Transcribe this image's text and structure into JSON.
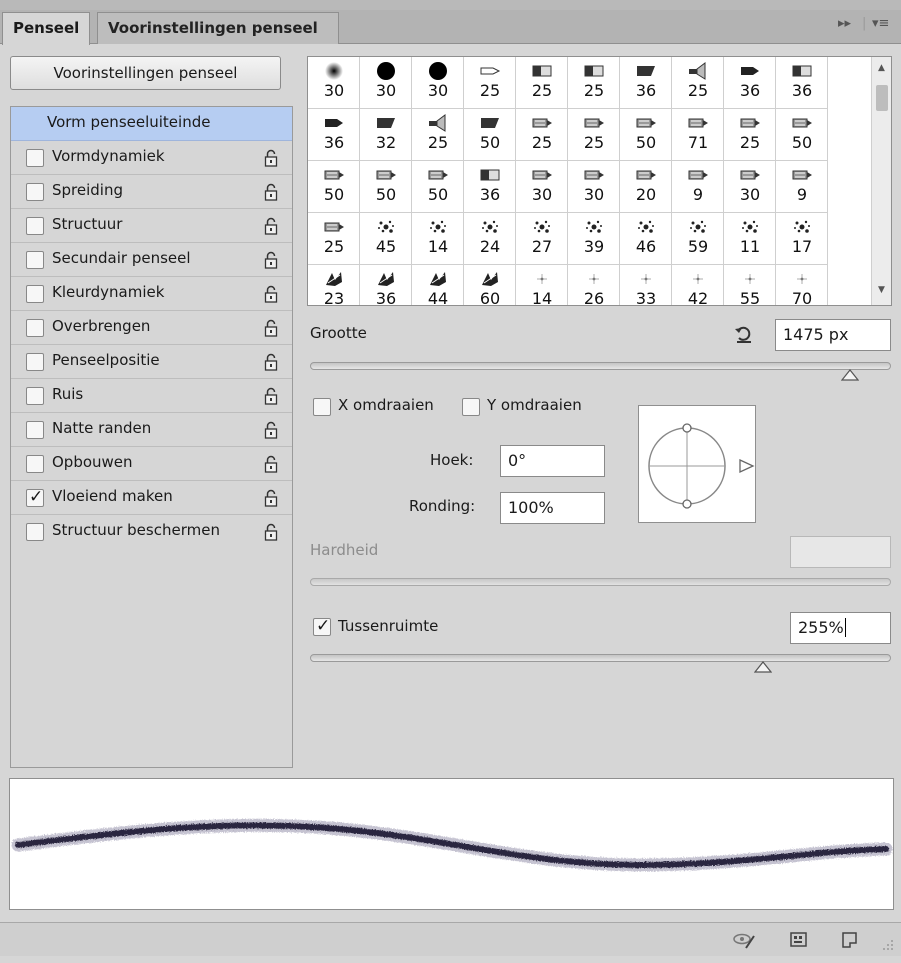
{
  "tabs": [
    {
      "label": "Penseel",
      "active": true
    },
    {
      "label": "Voorinstellingen penseel",
      "active": false
    }
  ],
  "preset_button": "Voorinstellingen penseel",
  "options": {
    "header": "Vorm penseeluiteinde",
    "items": [
      {
        "label": "Vormdynamiek",
        "checked": false
      },
      {
        "label": "Spreiding",
        "checked": false
      },
      {
        "label": "Structuur",
        "checked": false
      },
      {
        "label": "Secundair penseel",
        "checked": false
      },
      {
        "label": "Kleurdynamiek",
        "checked": false
      },
      {
        "label": "Overbrengen",
        "checked": false
      },
      {
        "label": "Penseelpositie",
        "checked": false
      },
      {
        "label": "Ruis",
        "checked": false
      },
      {
        "label": "Natte randen",
        "checked": false
      },
      {
        "label": "Opbouwen",
        "checked": false
      },
      {
        "label": "Vloeiend maken",
        "checked": true
      },
      {
        "label": "Structuur beschermen",
        "checked": false
      }
    ]
  },
  "brush_tips": [
    {
      "size": "30",
      "icon": "soft-round-brush-icon"
    },
    {
      "size": "30",
      "icon": "hard-round-brush-icon"
    },
    {
      "size": "30",
      "icon": "hard-round-brush-icon"
    },
    {
      "size": "25",
      "icon": "pencil-tip-brush-icon"
    },
    {
      "size": "25",
      "icon": "flat-brush-icon"
    },
    {
      "size": "25",
      "icon": "flat-brush-icon"
    },
    {
      "size": "36",
      "icon": "angled-flat-brush-icon"
    },
    {
      "size": "25",
      "icon": "fan-brush-icon"
    },
    {
      "size": "36",
      "icon": "marker-brush-icon"
    },
    {
      "size": "36",
      "icon": "flat-brush-icon"
    },
    {
      "size": "36",
      "icon": "marker-brush-icon"
    },
    {
      "size": "32",
      "icon": "angled-flat-brush-icon"
    },
    {
      "size": "25",
      "icon": "fan-brush-icon"
    },
    {
      "size": "50",
      "icon": "angled-flat-brush-icon"
    },
    {
      "size": "25",
      "icon": "bristle-brush-icon"
    },
    {
      "size": "25",
      "icon": "bristle-brush-icon"
    },
    {
      "size": "50",
      "icon": "bristle-brush-icon"
    },
    {
      "size": "71",
      "icon": "bristle-brush-icon"
    },
    {
      "size": "25",
      "icon": "bristle-brush-icon"
    },
    {
      "size": "50",
      "icon": "bristle-brush-icon"
    },
    {
      "size": "50",
      "icon": "bristle-brush-icon"
    },
    {
      "size": "50",
      "icon": "bristle-brush-icon"
    },
    {
      "size": "50",
      "icon": "bristle-brush-icon"
    },
    {
      "size": "36",
      "icon": "flat-brush-icon"
    },
    {
      "size": "30",
      "icon": "bristle-brush-icon"
    },
    {
      "size": "30",
      "icon": "bristle-brush-icon"
    },
    {
      "size": "20",
      "icon": "bristle-brush-icon"
    },
    {
      "size": "9",
      "icon": "bristle-brush-icon"
    },
    {
      "size": "30",
      "icon": "bristle-brush-icon"
    },
    {
      "size": "9",
      "icon": "bristle-brush-icon"
    },
    {
      "size": "25",
      "icon": "bristle-brush-icon"
    },
    {
      "size": "45",
      "icon": "scatter-brush-icon"
    },
    {
      "size": "14",
      "icon": "scatter-brush-icon"
    },
    {
      "size": "24",
      "icon": "scatter-brush-icon"
    },
    {
      "size": "27",
      "icon": "scatter-brush-icon"
    },
    {
      "size": "39",
      "icon": "scatter-brush-icon"
    },
    {
      "size": "46",
      "icon": "scatter-brush-icon"
    },
    {
      "size": "59",
      "icon": "scatter-brush-icon"
    },
    {
      "size": "11",
      "icon": "scatter-brush-icon"
    },
    {
      "size": "17",
      "icon": "scatter-brush-icon"
    },
    {
      "size": "23",
      "icon": "leaf-brush-icon"
    },
    {
      "size": "36",
      "icon": "leaf-brush-icon"
    },
    {
      "size": "44",
      "icon": "leaf-brush-icon"
    },
    {
      "size": "60",
      "icon": "leaf-brush-icon"
    },
    {
      "size": "14",
      "icon": "star-brush-icon"
    },
    {
      "size": "26",
      "icon": "star-brush-icon"
    },
    {
      "size": "33",
      "icon": "star-brush-icon"
    },
    {
      "size": "42",
      "icon": "star-brush-icon"
    },
    {
      "size": "55",
      "icon": "star-brush-icon"
    },
    {
      "size": "70",
      "icon": "star-brush-icon"
    }
  ],
  "size": {
    "label": "Grootte",
    "value": "1475 px",
    "slider_fraction": 0.93
  },
  "flip_x": {
    "label": "X omdraaien",
    "checked": false
  },
  "flip_y": {
    "label": "Y omdraaien",
    "checked": false
  },
  "angle": {
    "label": "Hoek:",
    "value": "0°"
  },
  "roundness": {
    "label": "Ronding:",
    "value": "100%"
  },
  "hardness": {
    "label": "Hardheid",
    "value": "",
    "disabled": true
  },
  "spacing": {
    "label": "Tussenruimte",
    "checked": true,
    "value": "255%",
    "slider_fraction": 0.78
  },
  "colors": {
    "panel": "#d6d6d6",
    "selection": "#b6cdf2",
    "stroke": "#2a2740"
  },
  "footer_icons": [
    "brush-visibility-icon",
    "brush-grid-icon",
    "new-preset-icon"
  ]
}
